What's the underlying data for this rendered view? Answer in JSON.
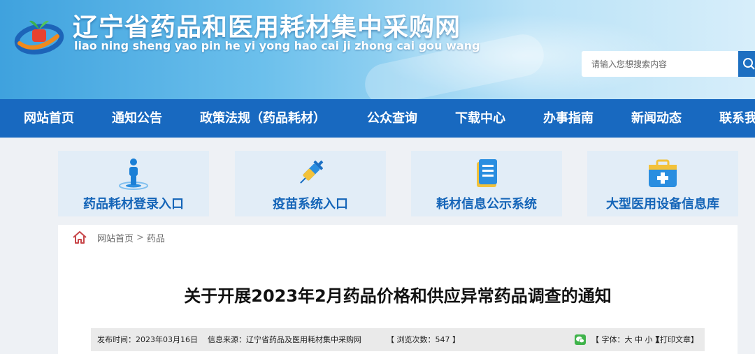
{
  "header": {
    "title": "辽宁省药品和医用耗材集中采购网",
    "pinyin": "liao ning sheng yao pin he yi yong hao cai ji zhong cai gou wang",
    "search_placeholder": "请输入您想搜索内容",
    "logo_icon": "site-logo-icon",
    "search_icon": "search-icon"
  },
  "nav": {
    "items": [
      "网站首页",
      "通知公告",
      "政策法规（药品耗材）",
      "公众查询",
      "下载中心",
      "办事指南",
      "新闻动态",
      "联系我"
    ]
  },
  "entries": [
    {
      "label": "药品耗材登录入口",
      "icon": "person-login-icon"
    },
    {
      "label": "疫苗系统入口",
      "icon": "syringe-icon"
    },
    {
      "label": "耗材信息公示系统",
      "icon": "document-list-icon"
    },
    {
      "label": "大型医用设备信息库",
      "icon": "medical-kit-icon"
    }
  ],
  "breadcrumb": {
    "home_icon": "home-icon",
    "items": [
      "网站首页",
      "药品"
    ],
    "separator": ">"
  },
  "article": {
    "title": "关于开展2023年2月药品价格和供应异常药品调查的通知",
    "publish_time": "发布时间：2023年03月16日",
    "source": "信息来源：辽宁省药品及医用耗材集中采购网",
    "views": "【 浏览次数：547 】",
    "font_size": "【 字体：大 中 小 】",
    "print": "【打印文章】",
    "share_icon": "wechat-icon"
  },
  "colors": {
    "nav_bg": "#1869c0",
    "entry_text": "#1565b8",
    "entry_bg": "#e2edf7",
    "header_gradient_start": "#3fa2de"
  }
}
